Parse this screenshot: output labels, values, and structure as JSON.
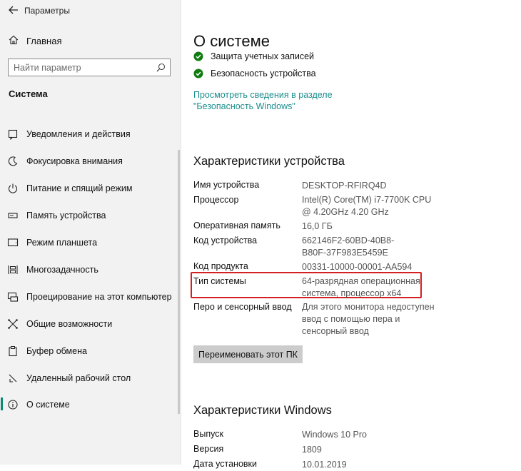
{
  "window": {
    "title": "Параметры"
  },
  "sidebar": {
    "home_label": "Главная",
    "search_placeholder": "Найти параметр",
    "section_heading": "Система",
    "items": [
      {
        "label": "Уведомления и действия",
        "icon": "notifications-icon"
      },
      {
        "label": "Фокусировка внимания",
        "icon": "focus-assist-icon"
      },
      {
        "label": "Питание и спящий режим",
        "icon": "power-icon"
      },
      {
        "label": "Память устройства",
        "icon": "storage-icon"
      },
      {
        "label": "Режим планшета",
        "icon": "tablet-icon"
      },
      {
        "label": "Многозадачность",
        "icon": "multitasking-icon"
      },
      {
        "label": "Проецирование на этот компьютер",
        "icon": "projecting-icon"
      },
      {
        "label": "Общие возможности",
        "icon": "shared-experiences-icon"
      },
      {
        "label": "Буфер обмена",
        "icon": "clipboard-icon"
      },
      {
        "label": "Удаленный рабочий стол",
        "icon": "remote-desktop-icon"
      },
      {
        "label": "О системе",
        "icon": "about-icon",
        "active": true
      }
    ]
  },
  "main": {
    "title": "О системе",
    "security": [
      {
        "label": "Защита учетных записей"
      },
      {
        "label": "Безопасность устройства"
      }
    ],
    "security_link_line1": "Просмотреть сведения в разделе",
    "security_link_line2": "\"Безопасность Windows\"",
    "device_specs": {
      "title": "Характеристики устройства",
      "rows": [
        {
          "label": "Имя устройства",
          "value": "DESKTOP-RFIRQ4D"
        },
        {
          "label": "Процессор",
          "value": "Intel(R) Core(TM) i7-7700K CPU @ 4.20GHz   4.20 GHz"
        },
        {
          "label": "Оперативная память",
          "value": "16,0 ГБ"
        },
        {
          "label": "Код устройства",
          "value": "662146F2-60BD-40B8-B80F-37F983E5459E"
        },
        {
          "label": "Код продукта",
          "value": "00331-10000-00001-AA594"
        },
        {
          "label": "Тип системы",
          "value": "64-разрядная операционная система, процессор x64"
        },
        {
          "label": "Перо и сенсорный ввод",
          "value": "Для этого монитора недоступен ввод с помощью пера и сенсорный ввод"
        }
      ],
      "rename_button": "Переименовать этот ПК"
    },
    "windows_specs": {
      "title": "Характеристики Windows",
      "rows": [
        {
          "label": "Выпуск",
          "value": "Windows 10 Pro"
        },
        {
          "label": "Версия",
          "value": "1809"
        },
        {
          "label": "Дата установки",
          "value": "10.01.2019"
        }
      ]
    }
  },
  "colors": {
    "accent": "#0b8a74",
    "check": "#107c10",
    "link": "#1a8d8d",
    "highlight": "#d42020"
  }
}
